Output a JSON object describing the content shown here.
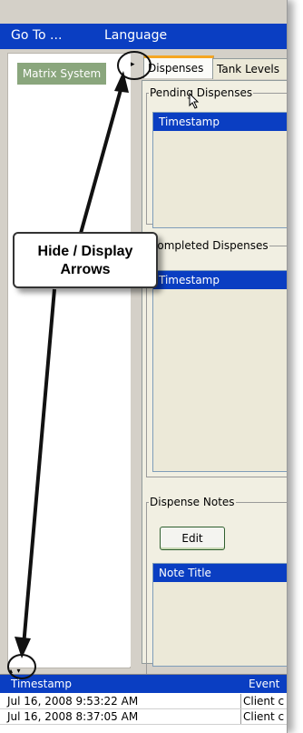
{
  "menu": {
    "goto": "Go To ...",
    "language": "Language"
  },
  "left": {
    "matrix_button": "Matrix System"
  },
  "divider": {
    "arrow_right": "▸"
  },
  "tabs": {
    "dispenses": "Dispenses",
    "tank_levels": "Tank Levels"
  },
  "pending": {
    "legend": "Pending Dispenses",
    "header": "Timestamp"
  },
  "completed": {
    "legend": "Completed Dispenses",
    "header": "Timestamp"
  },
  "notes": {
    "legend": "Dispense Notes",
    "edit_label": "Edit",
    "header": "Note Title"
  },
  "bottom": {
    "arrows": "▴ ▾",
    "columns": [
      "Timestamp",
      "Event"
    ],
    "rows": [
      [
        "Jul 16, 2008 9:53:22 AM",
        "Client c"
      ],
      [
        "Jul 16, 2008 8:37:05 AM",
        "Client c"
      ]
    ]
  },
  "annotation": {
    "line1": "Hide / Display",
    "line2": "Arrows"
  }
}
